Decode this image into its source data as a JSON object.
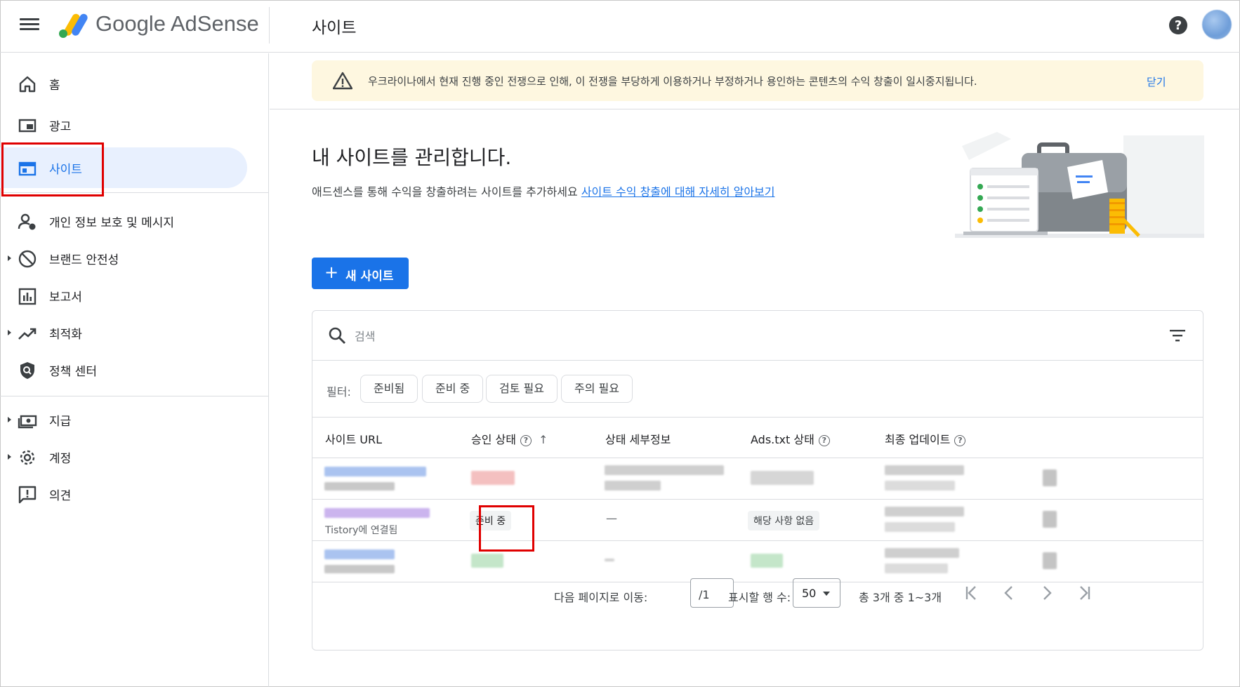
{
  "header": {
    "brand": "Google AdSense",
    "page_title": "사이트"
  },
  "sidebar": {
    "items": [
      {
        "label": "홈",
        "icon": "home-icon"
      },
      {
        "label": "광고",
        "icon": "ads-icon"
      },
      {
        "label": "사이트",
        "icon": "sites-icon",
        "active": true
      },
      {
        "label": "개인 정보 보호 및 메시지",
        "icon": "privacy-icon"
      },
      {
        "label": "브랜드 안전성",
        "icon": "block-icon"
      },
      {
        "label": "보고서",
        "icon": "reports-icon"
      },
      {
        "label": "최적화",
        "icon": "trending-icon"
      },
      {
        "label": "정책 센터",
        "icon": "policy-shield-icon"
      },
      {
        "label": "지급",
        "icon": "payments-icon"
      },
      {
        "label": "계정",
        "icon": "gear-icon"
      },
      {
        "label": "의견",
        "icon": "feedback-icon"
      }
    ]
  },
  "notice": {
    "message": "우크라이나에서 현재 진행 중인 전쟁으로 인해, 이 전쟁을 부당하게 이용하거나 부정하거나 용인하는 콘텐츠의 수익 창출이 일시중지됩니다.",
    "close_label": "닫기"
  },
  "hero": {
    "title": "내 사이트를 관리합니다.",
    "subtitle": "애드센스를 통해 수익을 창출하려는 사이트를 추가하세요",
    "link": "사이트 수익 창출에 대해 자세히 알아보기"
  },
  "new_site_label": "새 사이트",
  "search": {
    "placeholder": "검색"
  },
  "filters": {
    "label": "필터:",
    "chips": [
      "준비됨",
      "준비 중",
      "검토 필요",
      "주의 필요"
    ]
  },
  "table": {
    "headers": [
      "사이트 URL",
      "승인 상태",
      "상태 세부정보",
      "Ads.txt 상태",
      "최종 업데이트"
    ],
    "rows": [
      {
        "status": "",
        "detail": "",
        "ads_txt": "",
        "sub": ""
      },
      {
        "status": "준비 중",
        "detail": "—",
        "ads_txt": "해당 사항 없음",
        "sub": "Tistory에 연결됨"
      },
      {
        "status": "",
        "detail": "",
        "ads_txt": "",
        "sub": ""
      }
    ]
  },
  "pagination": {
    "goto_label": "다음 페이지로 이동:",
    "page_total": "/1",
    "rows_label": "표시할 행 수:",
    "rows_value": "50",
    "range_label": "총 3개 중 1~3개"
  },
  "colors": {
    "accent": "#1a73e8",
    "active_bg": "#e8f0fe",
    "notice_bg": "#fef7e0",
    "highlight_box": "#e00000"
  }
}
